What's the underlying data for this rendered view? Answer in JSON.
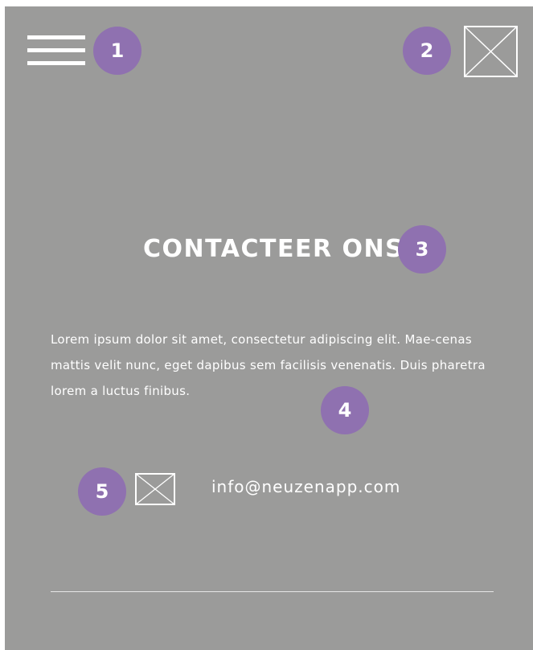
{
  "header": {
    "menu_icon": "hamburger-menu-icon",
    "logo_icon": "image-placeholder-icon"
  },
  "annotations": [
    "1",
    "2",
    "3",
    "4",
    "5"
  ],
  "contact": {
    "title": "CONTACTEER ONS",
    "body": "Lorem ipsum dolor sit amet, consectetur adipiscing elit. Mae-cenas mattis velit nunc, eget dapibus sem facilisis venenatis. Duis pharetra lorem a luctus finibus.",
    "email_icon": "image-placeholder-icon",
    "email": "info@neuzenapp.com"
  },
  "colors": {
    "background": "#9b9b9a",
    "badge": "#8f71b0",
    "text": "#ffffff"
  }
}
